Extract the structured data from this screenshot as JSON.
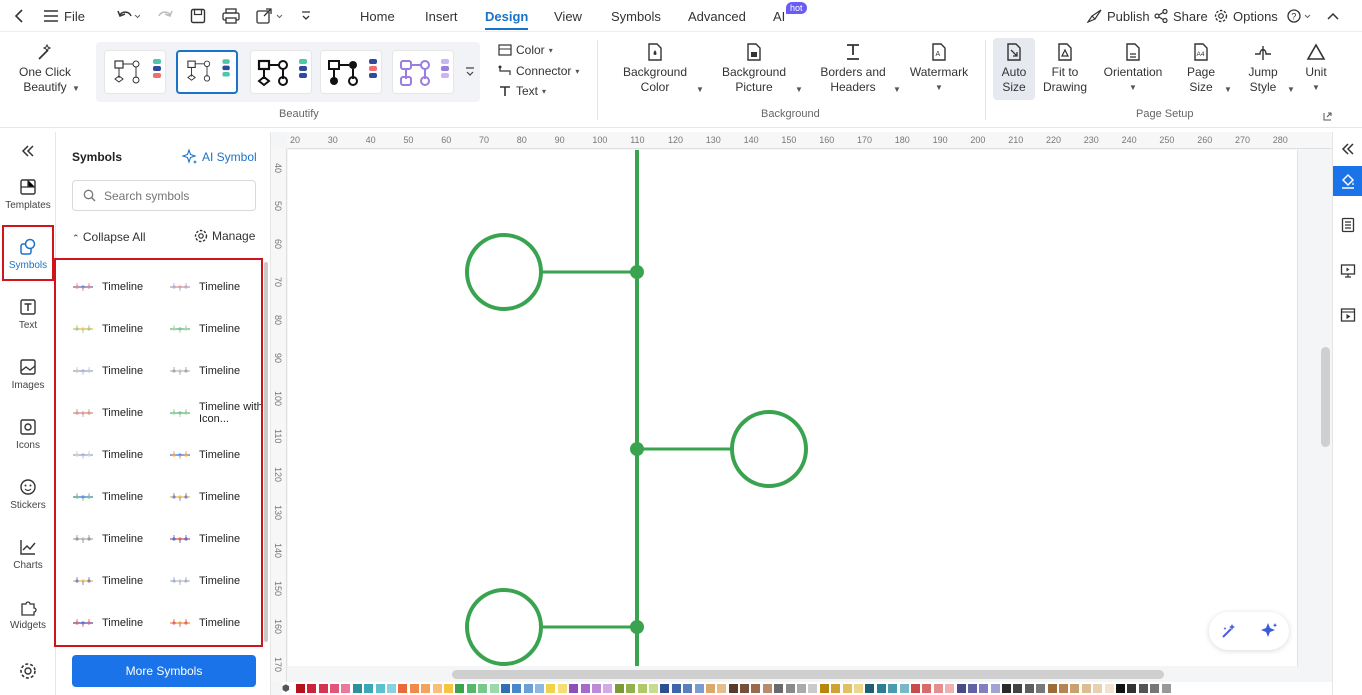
{
  "topbar": {
    "file": "File",
    "tabs": [
      "Home",
      "Insert",
      "Design",
      "View",
      "Symbols",
      "Advanced",
      "AI"
    ],
    "active_tab": "Design",
    "hot_badge": "hot",
    "publish": "Publish",
    "share": "Share",
    "options": "Options"
  },
  "ribbon": {
    "one_click_beautify": "One Click Beautify",
    "color": "Color",
    "connector": "Connector",
    "text": "Text",
    "background_color": "Background Color",
    "background_picture": "Background Picture",
    "borders_headers": "Borders and Headers",
    "watermark": "Watermark",
    "auto_size": "Auto Size",
    "fit_to_drawing": "Fit to Drawing",
    "orientation": "Orientation",
    "page_size": "Page Size",
    "jump_style": "Jump Style",
    "unit": "Unit",
    "groups": {
      "beautify": "Beautify",
      "background": "Background",
      "page_setup": "Page Setup"
    }
  },
  "rail": {
    "items": [
      "Templates",
      "Symbols",
      "Text",
      "Images",
      "Icons",
      "Stickers",
      "Charts",
      "Widgets"
    ],
    "active": "Symbols"
  },
  "panel": {
    "title": "Symbols",
    "ai_symbol": "AI Symbol",
    "search_placeholder": "Search symbols",
    "collapse_all": "Collapse All",
    "manage": "Manage",
    "symbols": [
      "Timeline",
      "Timeline",
      "Timeline",
      "Timeline",
      "Timeline",
      "Timeline",
      "Timeline",
      "Timeline with Icon...",
      "Timeline",
      "Timeline",
      "Timeline",
      "Timeline",
      "Timeline",
      "Timeline",
      "Timeline",
      "Timeline",
      "Timeline",
      "Timeline"
    ],
    "more_symbols": "More Symbols"
  },
  "ruler": {
    "h_ticks": [
      "20",
      "30",
      "40",
      "50",
      "60",
      "70",
      "80",
      "90",
      "100",
      "110",
      "120",
      "130",
      "140",
      "150",
      "160",
      "170",
      "180",
      "190",
      "200",
      "210",
      "220",
      "230",
      "240",
      "250",
      "260",
      "270",
      "280"
    ],
    "v_ticks": [
      "40",
      "50",
      "60",
      "70",
      "80",
      "90",
      "100",
      "110",
      "120",
      "130",
      "140",
      "150",
      "160",
      "170"
    ]
  },
  "colors": {
    "accent": "#1a73e8",
    "timeline_green": "#3aa34f",
    "highlight_red": "#d0141b",
    "palette": [
      "#b5121b",
      "#c9243a",
      "#d4344f",
      "#e0577a",
      "#e87aa0",
      "#2f8f9d",
      "#3aa8b8",
      "#5cc0cf",
      "#86d3df",
      "#e86a3a",
      "#f08a4b",
      "#f4a35f",
      "#f8be7a",
      "#f4c542",
      "#3aa34f",
      "#54b86a",
      "#76c98a",
      "#9ad9aa",
      "#2f6fb5",
      "#4a87c9",
      "#6aa0d8",
      "#8cb9e4",
      "#f2d14b",
      "#f6de74",
      "#8f4fb8",
      "#a56bc9",
      "#bd8ad8",
      "#d4aae6",
      "#7a9a3a",
      "#93b04f",
      "#aec86a",
      "#c7dc8c",
      "#2c4f8f",
      "#3f66a8",
      "#5a7fbf",
      "#7c9bd0",
      "#d9a86a",
      "#e4bd8a",
      "#5a3a2a",
      "#7a4f3a",
      "#9a6a50",
      "#ba8a6c",
      "#6a6a6a",
      "#8a8a8a",
      "#aaaaaa",
      "#cacaca",
      "#b8860b",
      "#cda434",
      "#e0c060",
      "#ecd690",
      "#1e5f74",
      "#2e7d96",
      "#4a9ab0",
      "#78b8c9",
      "#c94a4a",
      "#d86a6a",
      "#e48e8e",
      "#efb2b2",
      "#4a4a8a",
      "#6262a6",
      "#8080bf",
      "#a2a2d4",
      "#2a2a2a",
      "#444444",
      "#5e5e5e",
      "#787878",
      "#9c6b3a",
      "#b48552",
      "#caa070",
      "#dcbc92",
      "#e6d2b0",
      "#f0e4cc",
      "#111111",
      "#333333",
      "#555555",
      "#777777",
      "#999999"
    ]
  }
}
